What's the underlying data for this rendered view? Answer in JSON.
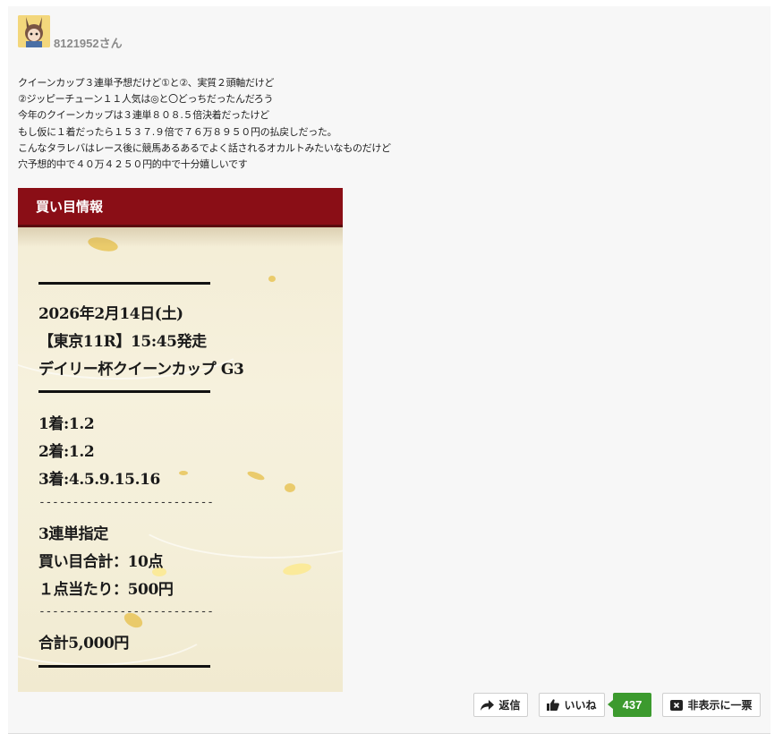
{
  "user": {
    "name": "8121952さん"
  },
  "comment": {
    "lines": [
      "クイーンカップ３連単予想だけど①と②、実質２頭軸だけど",
      "②ジッピーチューン１１人気は◎と〇どっちだったんだろう",
      "今年のクイーンカップは３連単８０８.５倍決着だったけど",
      "もし仮に１着だったら１５３７.９倍で７６万８９５０円の払戻しだった。",
      "こんなタラレバはレース後に競馬あるあるでよく話されるオカルトみたいなものだけど",
      "穴予想的中で４０万４２５０円的中で十分嬉しいです"
    ]
  },
  "ticket": {
    "header": "買い目情報",
    "date": "2026年2月14日(土)",
    "race": "【東京11R】15:45発走",
    "name": "デイリー杯クイーンカップ G3",
    "first": "1着:1.2",
    "second": "2着:1.2",
    "third": "3着:4.5.9.15.16",
    "dashes1": "--------------------------",
    "bet_type": "3連単指定",
    "total_points": "買い目合計：10点",
    "per_point": "１点当たり：500円",
    "dashes2": "--------------------------",
    "total": "合計5,000円"
  },
  "actions": {
    "reply_label": "返信",
    "like_label": "いいね",
    "like_count": "437",
    "hide_label": "非表示に一票"
  },
  "colors": {
    "header_red": "#8a0e16",
    "like_green": "#3c9a2e",
    "username_gray": "#8a8a8a"
  }
}
